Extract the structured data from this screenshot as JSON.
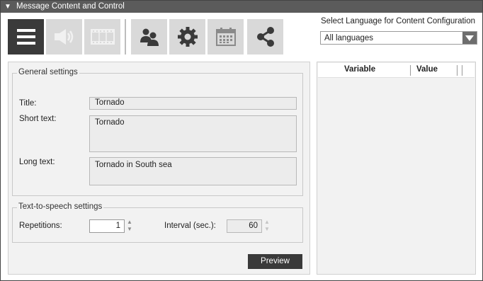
{
  "window": {
    "title": "Message Content and Control",
    "collapse_glyph": "▼"
  },
  "toolbar": {
    "buttons": [
      {
        "name": "content-menu-icon",
        "state": "active"
      },
      {
        "name": "audio-speaker-icon",
        "state": "disabled"
      },
      {
        "name": "film-strip-icon",
        "state": "disabled"
      },
      {
        "name": "people-group-icon",
        "state": "normal"
      },
      {
        "name": "gear-icon",
        "state": "normal"
      },
      {
        "name": "calendar-icon",
        "state": "normal"
      },
      {
        "name": "share-icon",
        "state": "normal"
      }
    ]
  },
  "language": {
    "label": "Select Language for Content Configuration",
    "selected": "All languages"
  },
  "general": {
    "legend": "General settings",
    "title_label": "Title:",
    "title_value": "Tornado",
    "short_label": "Short text:",
    "short_value": "Tornado",
    "long_label": "Long text:",
    "long_value": "Tornado in South sea"
  },
  "tts": {
    "legend": "Text-to-speech settings",
    "repetitions_label": "Repetitions:",
    "repetitions_value": "1",
    "interval_label": "Interval (sec.):",
    "interval_value": "60"
  },
  "actions": {
    "preview_label": "Preview"
  },
  "variables_table": {
    "columns": [
      "Variable",
      "Value"
    ],
    "rows": []
  },
  "colors": {
    "titlebar": "#5b5b5b",
    "active_button": "#3a3a3a",
    "inactive_button": "#d9d9d9",
    "panel_bg": "#f2f2f2"
  }
}
